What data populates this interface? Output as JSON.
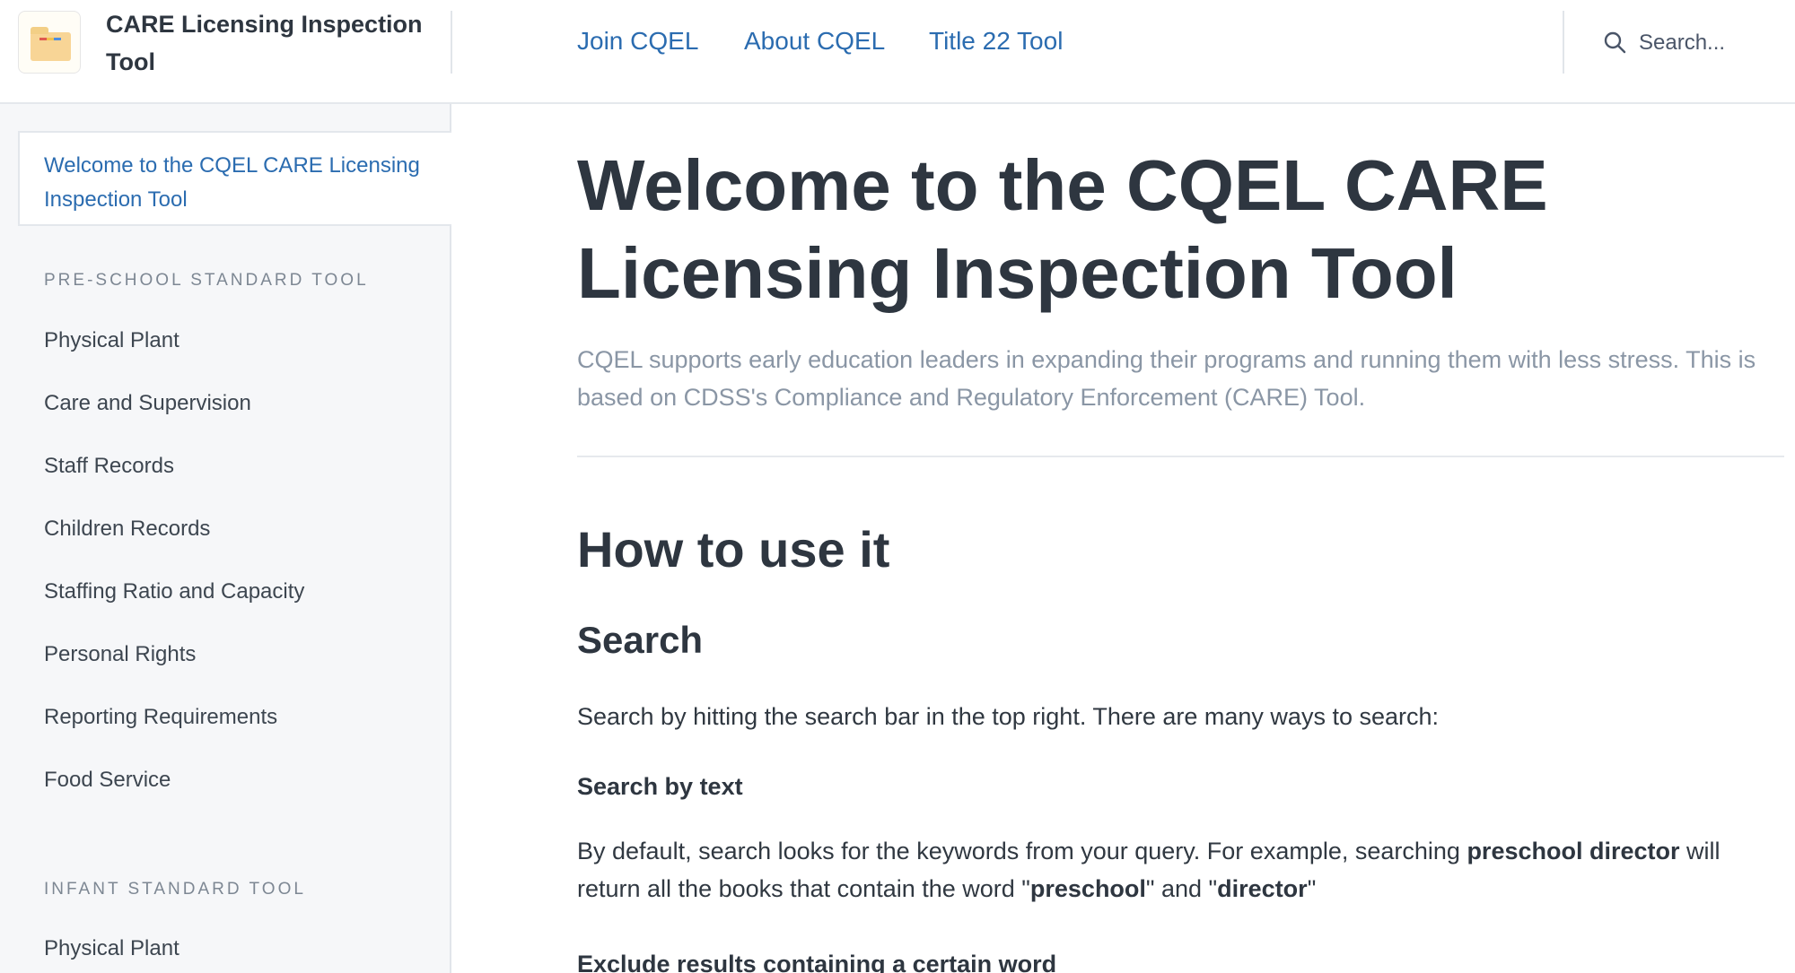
{
  "header": {
    "brand": "CARE Licensing Inspection Tool",
    "nav": [
      "Join CQEL",
      "About CQEL",
      "Title 22 Tool"
    ],
    "search_placeholder": "Search..."
  },
  "sidebar": {
    "active": "Welcome to the CQEL CARE Licensing Inspection Tool",
    "sections": [
      {
        "title": "PRE-SCHOOL STANDARD TOOL",
        "items": [
          "Physical Plant",
          "Care and Supervision",
          "Staff Records",
          "Children Records",
          "Staffing Ratio and Capacity",
          "Personal Rights",
          "Reporting Requirements",
          "Food Service"
        ]
      },
      {
        "title": "INFANT STANDARD TOOL",
        "items": [
          "Physical Plant"
        ]
      }
    ]
  },
  "main": {
    "title": "Welcome to the CQEL CARE Licensing Inspection Tool",
    "lede": "CQEL supports early education leaders in expanding their programs and running them with less stress. This is based on CDSS's Compliance and Regulatory Enforcement (CARE) Tool.",
    "how_heading": "How to use it",
    "search_heading": "Search",
    "search_intro": "Search by hitting the search bar in the top right. There are many ways to search:",
    "search_by_text_heading": "Search by text",
    "search_by_text_body": {
      "t1": "By default, search looks for the keywords from your query. For example, searching ",
      "b1": "preschool director",
      "t2": " will return all the books that contain the word \"",
      "b2": "preschool",
      "t3": "\" and \"",
      "b3": "director",
      "t4": "\""
    },
    "exclude_heading": "Exclude results containing a certain word"
  },
  "colors": {
    "link": "#2b6cb0",
    "heading": "#2e3640",
    "muted": "#8a96a5",
    "sidebar_bg": "#f6f7f9"
  }
}
